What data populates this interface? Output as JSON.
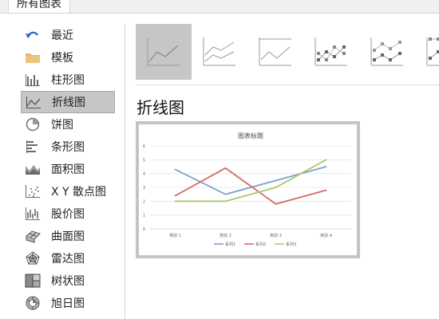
{
  "tab": {
    "label": "所有图表"
  },
  "sidebar": {
    "items": [
      {
        "label": "最近",
        "icon": "recent-icon"
      },
      {
        "label": "模板",
        "icon": "folder-icon"
      },
      {
        "label": "柱形图",
        "icon": "column-chart-icon"
      },
      {
        "label": "折线图",
        "icon": "line-chart-icon",
        "selected": true
      },
      {
        "label": "饼图",
        "icon": "pie-chart-icon"
      },
      {
        "label": "条形图",
        "icon": "bar-chart-icon"
      },
      {
        "label": "面积图",
        "icon": "area-chart-icon"
      },
      {
        "label": "X Y 散点图",
        "icon": "scatter-chart-icon"
      },
      {
        "label": "股价图",
        "icon": "stock-chart-icon"
      },
      {
        "label": "曲面图",
        "icon": "surface-chart-icon"
      },
      {
        "label": "雷达图",
        "icon": "radar-chart-icon"
      },
      {
        "label": "树状图",
        "icon": "treemap-icon"
      },
      {
        "label": "旭日图",
        "icon": "sunburst-icon"
      }
    ]
  },
  "subtypes": [
    {
      "icon": "line-subtype-icon",
      "selected": true
    },
    {
      "icon": "stacked-line-subtype-icon"
    },
    {
      "icon": "percent-stacked-line-subtype-icon"
    },
    {
      "icon": "line-with-markers-subtype-icon"
    },
    {
      "icon": "stacked-line-with-markers-subtype-icon"
    },
    {
      "icon": "percent-stacked-line-with-markers-subtype-icon"
    }
  ],
  "section": {
    "title": "折线图"
  },
  "colors": {
    "series1": "#7f9fcf",
    "series2": "#d46a6a",
    "series3": "#a9c86e",
    "selected_bg": "#c6c6c6"
  },
  "chart_data": {
    "type": "line",
    "title": "图表标题",
    "categories": [
      "类别 1",
      "类别 2",
      "类别 3",
      "类别 4"
    ],
    "series": [
      {
        "name": "系列1",
        "values": [
          4.3,
          2.5,
          3.5,
          4.5
        ]
      },
      {
        "name": "系列2",
        "values": [
          2.4,
          4.4,
          1.8,
          2.8
        ]
      },
      {
        "name": "系列3",
        "values": [
          2.0,
          2.0,
          3.0,
          5.0
        ]
      }
    ],
    "yticks": [
      "0",
      "1",
      "2",
      "3",
      "4",
      "5",
      "6"
    ],
    "ylim": [
      0,
      6
    ],
    "grid": true,
    "legend": "bottom"
  }
}
